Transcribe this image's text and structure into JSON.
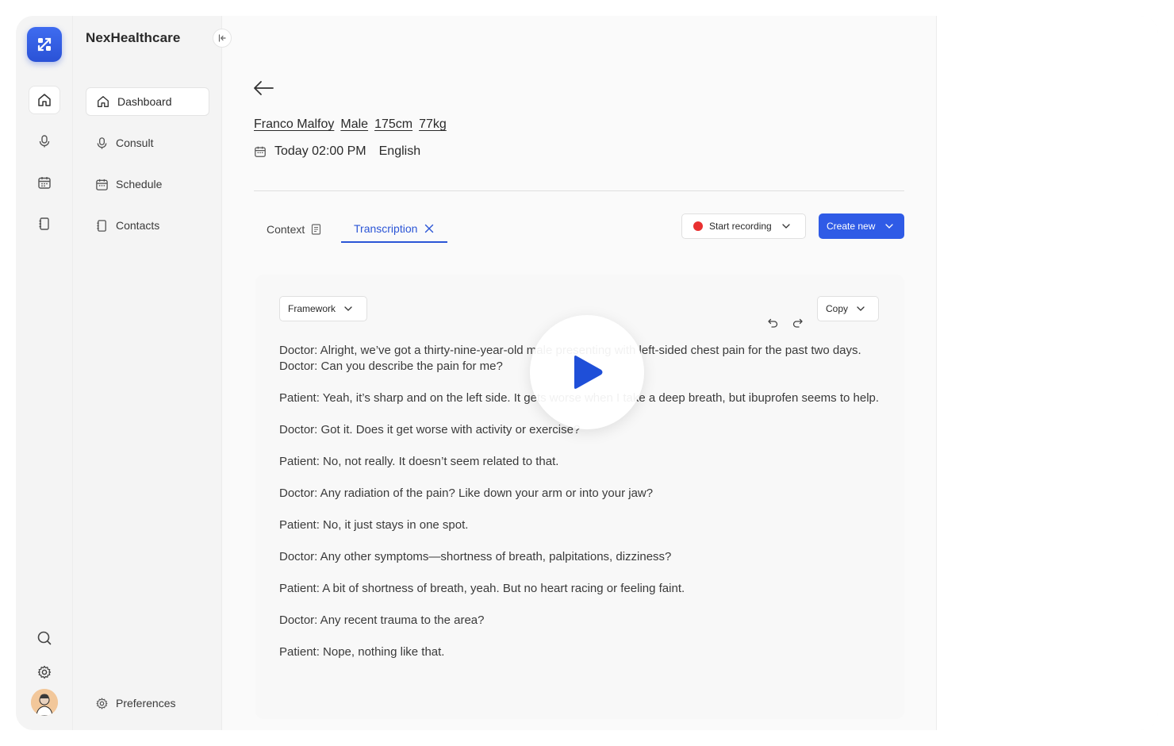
{
  "app": {
    "brand": "NexHealthcare"
  },
  "nav": {
    "items": [
      {
        "label": "Dashboard",
        "icon": "home-icon",
        "active": true
      },
      {
        "label": "Consult",
        "icon": "microphone-icon"
      },
      {
        "label": "Schedule",
        "icon": "calendar-icon"
      },
      {
        "label": "Contacts",
        "icon": "contacts-book-icon"
      }
    ],
    "preferences": "Preferences"
  },
  "patient": {
    "name": "Franco Malfoy",
    "sex": "Male",
    "height": "175cm",
    "weight": "77kg"
  },
  "appointment": {
    "when": "Today 02:00 PM",
    "language": "English"
  },
  "tabs": {
    "context": "Context",
    "transcription": "Transcription",
    "active": "transcription"
  },
  "actions": {
    "start_recording": "Start recording",
    "create_new": "Create new"
  },
  "toolbar": {
    "framework": "Framework",
    "copy": "Copy"
  },
  "transcript": [
    {
      "lines": [
        "Doctor: Alright, we’ve got a thirty-nine-year-old male presenting with left-sided chest pain for the past two days.",
        "Doctor: Can you describe the pain for me?"
      ]
    },
    {
      "lines": [
        "Patient: Yeah, it’s sharp and on the left side. It gets worse when I take a deep breath, but ibuprofen seems to help."
      ]
    },
    {
      "lines": [
        "Doctor: Got it. Does it get worse with activity or exercise?"
      ]
    },
    {
      "lines": [
        "Patient: No, not really. It doesn’t seem related to that."
      ]
    },
    {
      "lines": [
        "Doctor: Any radiation of the pain? Like down your arm or into your jaw?"
      ]
    },
    {
      "lines": [
        "Patient: No, it just stays in one spot."
      ]
    },
    {
      "lines": [
        "Doctor: Any other symptoms—shortness of breath, palpitations, dizziness?"
      ]
    },
    {
      "lines": [
        "Patient: A bit of shortness of breath, yeah. But no heart racing or feeling faint."
      ]
    },
    {
      "lines": [
        "Doctor: Any recent trauma to the area?"
      ]
    },
    {
      "lines": [
        "Patient: Nope, nothing like that."
      ]
    }
  ],
  "colors": {
    "accent": "#2f5be6",
    "record": "#e93030"
  }
}
